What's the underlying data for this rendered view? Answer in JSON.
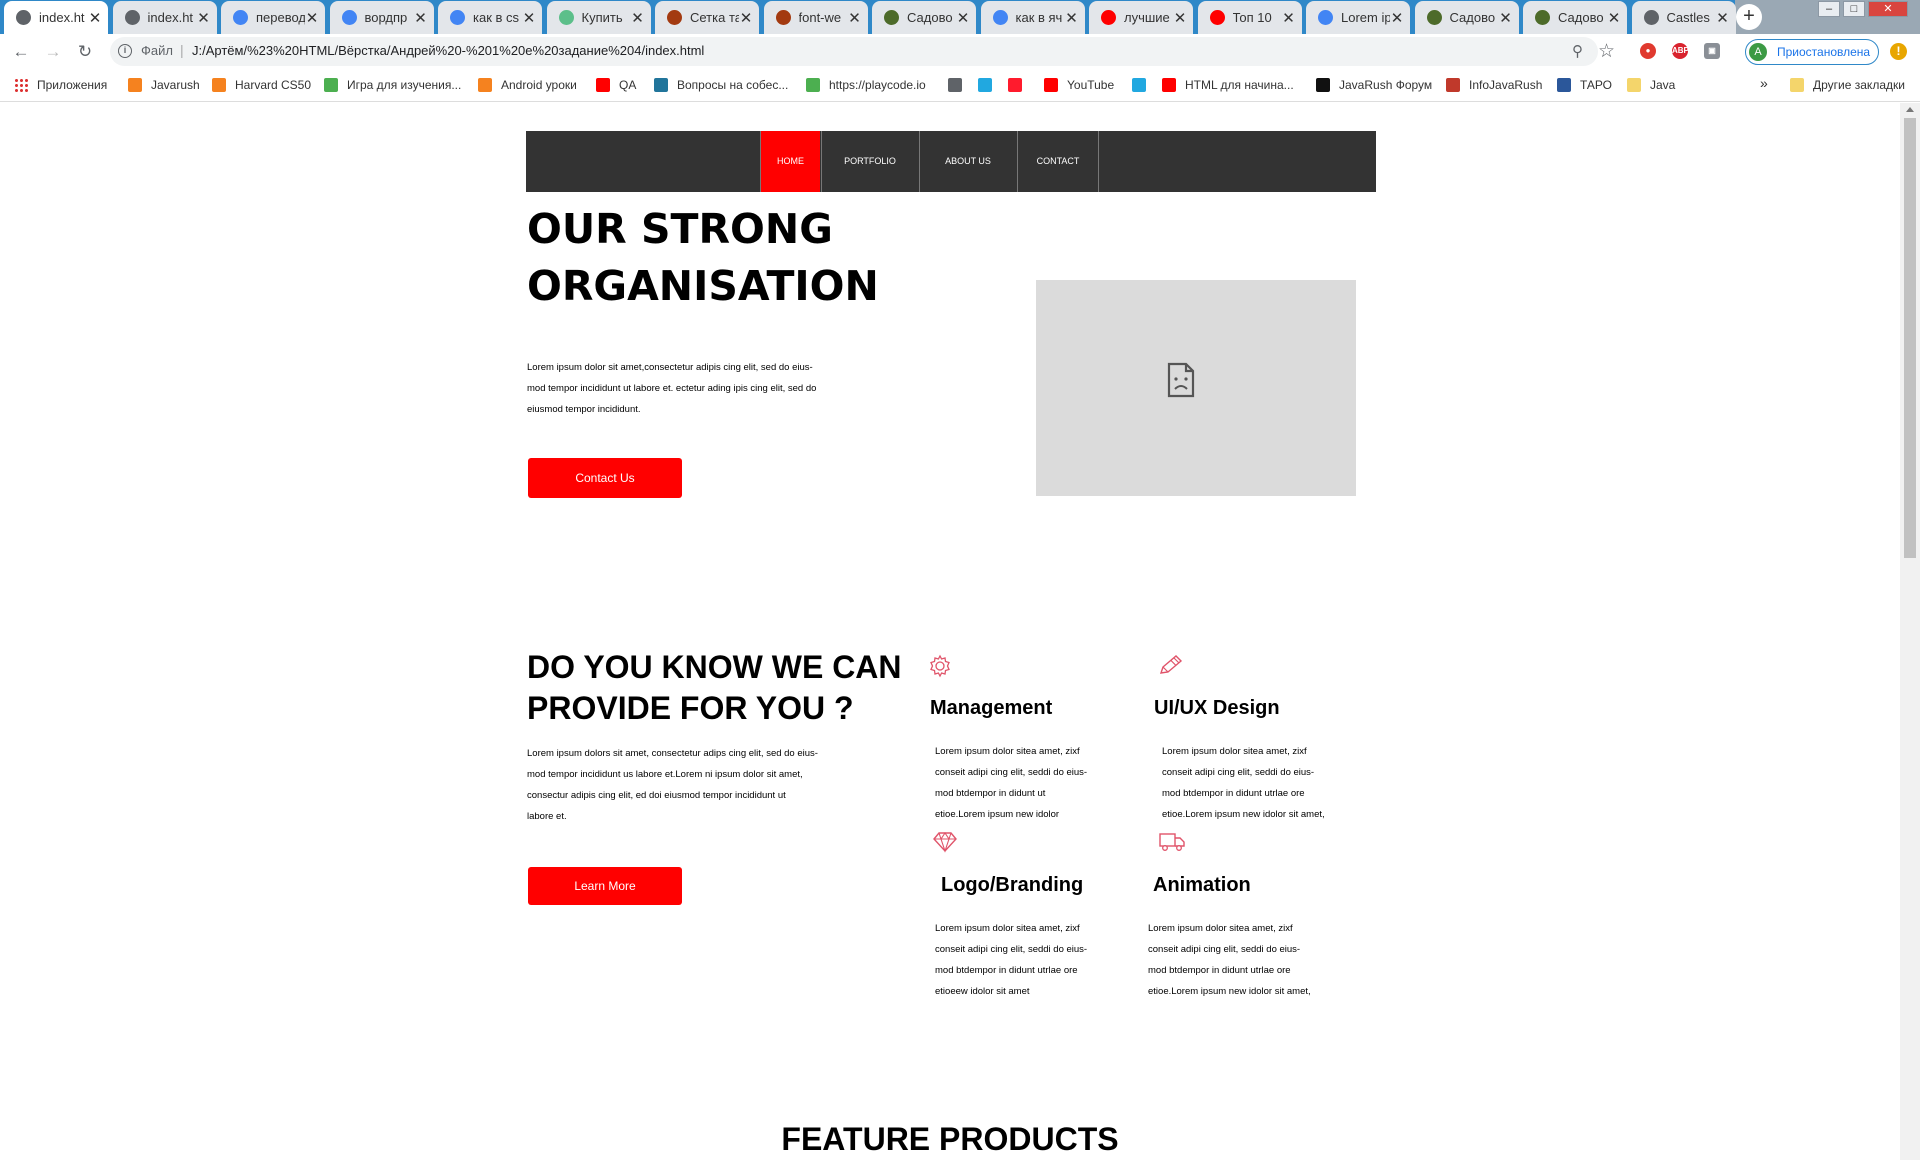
{
  "browser": {
    "tabs": [
      {
        "label": "index.ht",
        "icon": "globe-icon",
        "color": "#5f6368",
        "active": true
      },
      {
        "label": "index.ht",
        "icon": "globe-icon",
        "color": "#5f6368"
      },
      {
        "label": "перевод",
        "icon": "google-icon",
        "color": "#4285f4"
      },
      {
        "label": "вордпр",
        "icon": "google-icon",
        "color": "#4285f4"
      },
      {
        "label": "как в cs",
        "icon": "google-icon",
        "color": "#4285f4"
      },
      {
        "label": "Купить",
        "icon": "leaf-icon",
        "color": "#5cbf8a"
      },
      {
        "label": "Сетка та",
        "icon": "site-icon",
        "color": "#a33a10"
      },
      {
        "label": "font-we",
        "icon": "site-icon",
        "color": "#a33a10"
      },
      {
        "label": "Садово",
        "icon": "image-icon",
        "color": "#4d6b2a"
      },
      {
        "label": "как в яч",
        "icon": "google-icon",
        "color": "#4285f4"
      },
      {
        "label": "лучшие",
        "icon": "youtube-icon",
        "color": "#ff0000"
      },
      {
        "label": "Топ 10",
        "icon": "youtube-icon",
        "color": "#ff0000"
      },
      {
        "label": "Lorem ip",
        "icon": "google-icon",
        "color": "#4285f4"
      },
      {
        "label": "Садово",
        "icon": "image-icon",
        "color": "#4d6b2a"
      },
      {
        "label": "Садово",
        "icon": "image-icon",
        "color": "#4d6b2a"
      },
      {
        "label": "Castles",
        "icon": "globe-icon",
        "color": "#5f6368"
      }
    ],
    "close_glyph": "✕",
    "new_tab_glyph": "+",
    "address": {
      "scheme_label": "Файл",
      "separator": "|",
      "url": "J:/Артём/%23%20HTML/Вёрстка/Андрей%20-%201%20е%20задание%204/index.html"
    },
    "profile": {
      "initial": "A",
      "label": "Приостановлена"
    },
    "bookmarks": [
      {
        "label": "Приложения",
        "icon": "apps-grid-icon",
        "color": "#d33"
      },
      {
        "label": "Javarush",
        "icon": "javarush-icon",
        "color": "#f5821f"
      },
      {
        "label": "Harvard CS50",
        "icon": "harvard-icon",
        "color": "#f5821f"
      },
      {
        "label": "Игра для изучения...",
        "icon": "game-icon",
        "color": "#4caf50"
      },
      {
        "label": "Android уроки",
        "icon": "android-icon",
        "color": "#f5821f"
      },
      {
        "label": "QA",
        "icon": "youtube-icon",
        "color": "#ff0000"
      },
      {
        "label": "Вопросы на собес...",
        "icon": "wordpress-icon",
        "color": "#21759b"
      },
      {
        "label": "https://playcode.io",
        "icon": "playcode-icon",
        "color": "#4caf50"
      },
      {
        "label": "",
        "icon": "globe-icon",
        "color": "#5f6368"
      },
      {
        "label": "",
        "icon": "star-icon",
        "color": "#21a8e0"
      },
      {
        "label": "",
        "icon": "opera-icon",
        "color": "#ff1b2d"
      },
      {
        "label": "YouTube",
        "icon": "youtube-icon",
        "color": "#ff0000"
      },
      {
        "label": "",
        "icon": "video-icon",
        "color": "#21a8e0"
      },
      {
        "label": "HTML для начина...",
        "icon": "youtube-icon",
        "color": "#ff0000"
      },
      {
        "label": "JavaRush Форум",
        "icon": "jr-icon",
        "color": "#111"
      },
      {
        "label": "InfoJavaRush",
        "icon": "infojava-icon",
        "color": "#c0392b"
      },
      {
        "label": "ТАРО",
        "icon": "word-icon",
        "color": "#2b579a"
      },
      {
        "label": "Java",
        "icon": "folder-icon",
        "color": "#f4d56b"
      }
    ],
    "overflow": "»",
    "other_bookmarks": "Другие закладки"
  },
  "site": {
    "nav": [
      {
        "label": "HOME",
        "active": true
      },
      {
        "label": "PORTFOLIO"
      },
      {
        "label": "ABOUT US"
      },
      {
        "label": "CONTACT"
      }
    ],
    "hero": {
      "title_line1": "OUR STRONG",
      "title_line2": "ORGANISATION",
      "text": [
        "Lorem ipsum dolor sit amet,consectetur adipis cing elit, sed do eius-",
        "mod tempor incididunt ut labore et. ectetur ading ipis cing elit, sed do",
        "eiusmod tempor incididunt."
      ],
      "button": "Contact Us"
    },
    "services": {
      "title_line1": "DO YOU KNOW WE CAN",
      "title_line2": "PROVIDE FOR YOU ?",
      "text": [
        "Lorem ipsum dolors sit amet, consectetur adips cing elit, sed do eius-",
        "mod tempor incididunt us labore et.Lorem ni ipsum dolor sit amet,",
        "consectur adipis cing elit, ed doi eiusmod tempor incididunt ut",
        "labore et."
      ],
      "button": "Learn More",
      "items": [
        {
          "title": "Management",
          "icon": "gear-icon",
          "text": [
            "Lorem ipsum dolor sitea amet, zixf",
            "conseit adipi cing elit, seddi do eius-",
            "mod btdempor in didunt ut",
            "etioe.Lorem ipsum new idolor"
          ]
        },
        {
          "title": "UI/UX Design",
          "icon": "pencil-icon",
          "text": [
            "Lorem ipsum dolor sitea amet, zixf",
            "conseit adipi cing elit, seddi do eius-",
            "mod btdempor in didunt utrlae ore",
            "etioe.Lorem ipsum new idolor sit amet,"
          ]
        },
        {
          "title": "Logo/Branding",
          "icon": "diamond-icon",
          "text": [
            "Lorem ipsum dolor sitea amet, zixf",
            "conseit adipi cing elit, seddi do eius-",
            "mod btdempor in didunt utrlae ore",
            "etioeew idolor sit amet"
          ]
        },
        {
          "title": "Animation",
          "icon": "truck-icon",
          "text": [
            "Lorem ipsum dolor sitea amet, zixf",
            "conseit adipi cing elit, seddi do eius-",
            "mod btdempor in didunt utrlae ore",
            "etioe.Lorem ipsum new idolor sit amet,"
          ]
        }
      ]
    },
    "feature_title": "FEATURE PRODUCTS",
    "colors": {
      "accent": "#ff0000",
      "nav_bg": "#333333",
      "placeholder": "#dbdbdb",
      "icon": "#e0546a"
    }
  }
}
